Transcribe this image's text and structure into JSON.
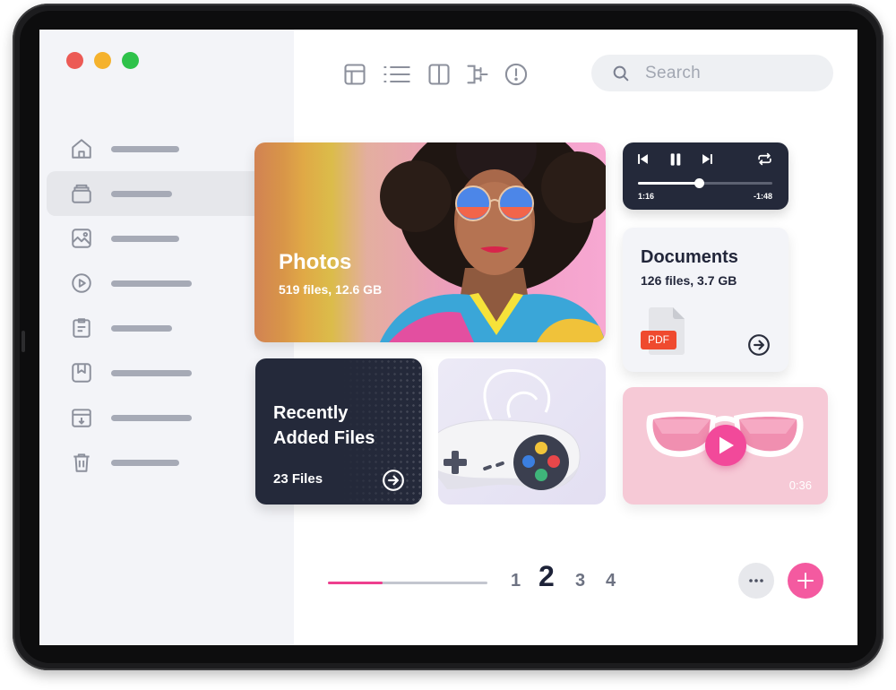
{
  "window": {
    "traffic_lights": [
      {
        "name": "close",
        "color": "#ec5a55"
      },
      {
        "name": "minimize",
        "color": "#f5b22d"
      },
      {
        "name": "maximize",
        "color": "#2ec24a"
      }
    ]
  },
  "sidebar": {
    "active_index": 1,
    "items": [
      {
        "icon": "home-icon"
      },
      {
        "icon": "box-icon"
      },
      {
        "icon": "image-icon"
      },
      {
        "icon": "play-circle-icon"
      },
      {
        "icon": "clipboard-icon"
      },
      {
        "icon": "bookmark-icon"
      },
      {
        "icon": "archive-download-icon"
      },
      {
        "icon": "trash-icon"
      }
    ]
  },
  "toolbar": {
    "icons": [
      "grid-layout-icon",
      "list-view-icon",
      "split-view-icon",
      "hierarchy-icon",
      "info-alert-icon"
    ],
    "search": {
      "placeholder": "Search"
    }
  },
  "cards": {
    "photos": {
      "title": "Photos",
      "subtitle": "519 files, 12.6 GB"
    },
    "player": {
      "elapsed": "1:16",
      "remaining": "-1:48",
      "progress": 0.45
    },
    "documents": {
      "title": "Documents",
      "subtitle": "126 files, 3.7 GB",
      "file_badge": "PDF"
    },
    "recent": {
      "title": "Recently Added Files",
      "subtitle": "23 Files"
    },
    "game": {
      "icon": "game-controller-icon"
    },
    "video": {
      "duration": "0:36"
    }
  },
  "pagination": {
    "pages": [
      "1",
      "2",
      "3",
      "4"
    ],
    "current": "2",
    "progress": 0.34
  },
  "colors": {
    "accent": "#f45aa0",
    "dark_card": "#24293a",
    "sidebar_bg": "#f3f4f8"
  }
}
